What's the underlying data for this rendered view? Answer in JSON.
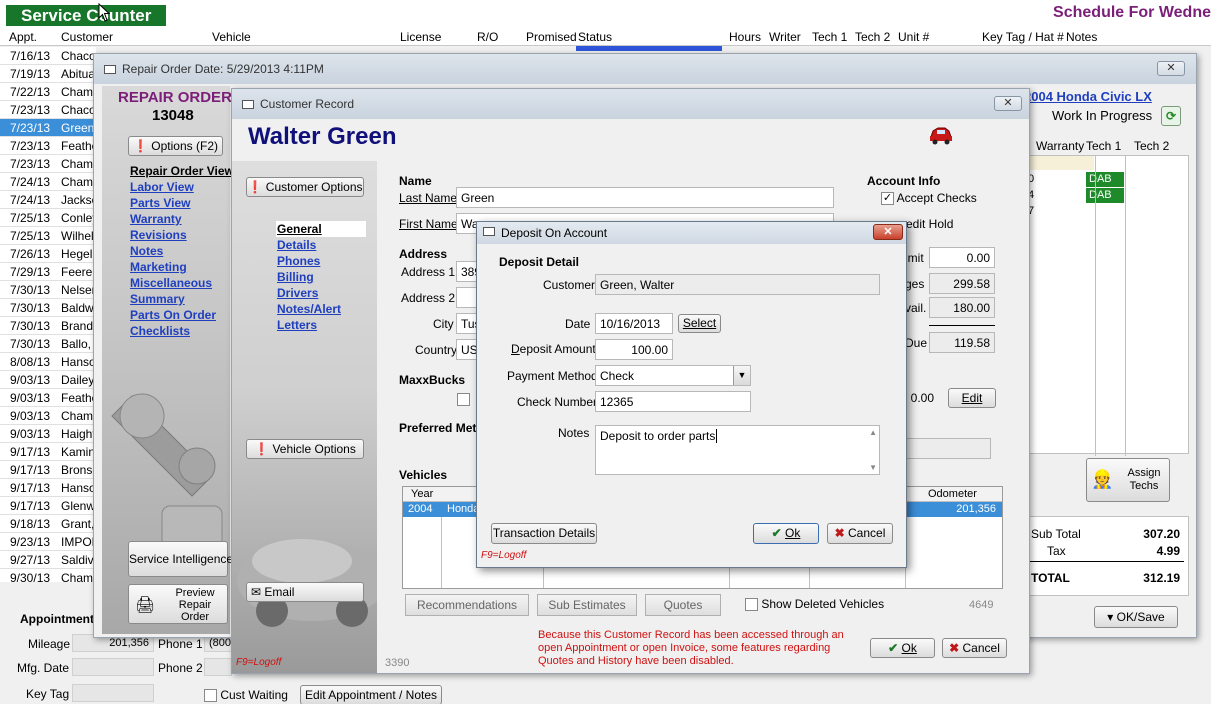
{
  "top": {
    "app_title": "Service Counter",
    "schedule_title": "Schedule For Wedne"
  },
  "grid": {
    "headers": [
      "Appt.",
      "Customer",
      "Vehicle",
      "License",
      "R/O",
      "Promised",
      "Status",
      "Hours",
      "Writer",
      "Tech 1",
      "Tech 2",
      "Unit #",
      "Key Tag / Hat #",
      "Notes"
    ],
    "rows": [
      {
        "date": "7/16/13",
        "cust": "Chaco"
      },
      {
        "date": "7/19/13",
        "cust": "Abitua"
      },
      {
        "date": "7/22/13",
        "cust": "Chamb"
      },
      {
        "date": "7/23/13",
        "cust": "Chaco"
      },
      {
        "date": "7/23/13",
        "cust": "Green"
      },
      {
        "date": "7/23/13",
        "cust": "Feathe"
      },
      {
        "date": "7/23/13",
        "cust": "Chamb"
      },
      {
        "date": "7/24/13",
        "cust": "Chamb"
      },
      {
        "date": "7/24/13",
        "cust": "Jackso"
      },
      {
        "date": "7/25/13",
        "cust": "Conley"
      },
      {
        "date": "7/25/13",
        "cust": "Wilhelr"
      },
      {
        "date": "7/26/13",
        "cust": "Hegel,"
      },
      {
        "date": "7/29/13",
        "cust": "Feerer"
      },
      {
        "date": "7/30/13",
        "cust": "Nelser"
      },
      {
        "date": "7/30/13",
        "cust": "Baldwi"
      },
      {
        "date": "7/30/13",
        "cust": "Brande"
      },
      {
        "date": "7/30/13",
        "cust": "Ballo,"
      },
      {
        "date": "8/08/13",
        "cust": "Hanso"
      },
      {
        "date": "9/03/13",
        "cust": "Dailey"
      },
      {
        "date": "9/03/13",
        "cust": "Feathe"
      },
      {
        "date": "9/03/13",
        "cust": "Chamb"
      },
      {
        "date": "9/03/13",
        "cust": "Haight"
      },
      {
        "date": "9/17/13",
        "cust": "Kamins"
      },
      {
        "date": "9/17/13",
        "cust": "Bronsc"
      },
      {
        "date": "9/17/13",
        "cust": "Hanso"
      },
      {
        "date": "9/17/13",
        "cust": "Glenw"
      },
      {
        "date": "9/18/13",
        "cust": "Grant,"
      },
      {
        "date": "9/23/13",
        "cust": "IMPOR"
      },
      {
        "date": "9/27/13",
        "cust": "Saldiva"
      },
      {
        "date": "9/30/13",
        "cust": "Chamb"
      }
    ]
  },
  "bottom": {
    "appointment_label": "Appointment",
    "mileage_label": "Mileage",
    "mileage_value": "201,356",
    "mfg_date_label": "Mfg. Date",
    "key_tag_label": "Key Tag",
    "phone1_label": "Phone 1",
    "phone1_value": "(800",
    "phone2_label": "Phone 2",
    "cust_waiting_label": "Cust Waiting",
    "edit_appt_label": "Edit Appointment / Notes"
  },
  "ro": {
    "title": "Repair Order Date:  5/29/2013   4:11PM",
    "close": "✕",
    "heading": "REPAIR ORDER",
    "number": "13048",
    "options_label": "Options (F2)",
    "links": [
      "Repair Order View",
      "Labor View",
      "Parts View",
      "Warranty",
      "Revisions",
      "Notes",
      "Marketing",
      "Miscellaneous",
      "Summary",
      "Parts On Order",
      "Checklists"
    ],
    "service_intelligence": "Service Intelligence",
    "preview_label": "Preview Repair Order",
    "vehicle_link": "2004 Honda  Civic LX",
    "status": "Work In Progress",
    "line_headers": [
      "Warranty",
      "Tech 1",
      "Tech 2"
    ],
    "line_frag": [
      "0",
      "4",
      "7"
    ],
    "tech1_values": [
      "DAB",
      "DAB"
    ],
    "assign_techs": "Assign Techs",
    "totals": {
      "sub_total_label": "Sub Total",
      "sub_total_value": "307.20",
      "tax_label": "Tax",
      "tax_value": "4.99",
      "total_label": "TOTAL",
      "total_value": "312.19"
    },
    "ok_save": "OK/Save"
  },
  "cr": {
    "title": "Customer Record",
    "close": "✕",
    "customer_name": "Walter Green",
    "customer_options": "Customer Options",
    "tabs": [
      "General",
      "Details",
      "Phones",
      "Billing",
      "Drivers",
      "Notes/Alert",
      "Letters"
    ],
    "vehicle_options": "Vehicle Options",
    "email": "Email",
    "f9": "F9=Logoff",
    "name_group": "Name",
    "last_name_label": "Last Name",
    "last_name_value": "Green",
    "first_name_label": "First Name",
    "first_name_value": "Wa",
    "address_group": "Address",
    "address1_label": "Address 1",
    "address1_value": "389",
    "address2_label": "Address 2",
    "city_label": "City",
    "city_value": "Tus",
    "country_label": "Country",
    "country_value": "US",
    "maxxbucks_label": "MaxxBucks",
    "preferred_label": "Preferred Met",
    "vehicles_group": "Vehicles",
    "veh_headers": [
      "Year",
      "Odometer"
    ],
    "veh_row": {
      "year": "2004",
      "make": "Honda",
      "odometer": "201,356"
    },
    "account_info": "Account Info",
    "accept_checks": "Accept Checks",
    "credit_hold": "edit Hold",
    "account_values": [
      {
        "label": "imit",
        "value": "0.00"
      },
      {
        "label": "ges",
        "value": "299.58"
      },
      {
        "label": "vail.",
        "value": "180.00"
      },
      {
        "label": "Due",
        "value": "119.58"
      }
    ],
    "maxx_value": "0.00",
    "edit_btn": "Edit",
    "recommendations": "Recommendations",
    "sub_estimates": "Sub Estimates",
    "quotes": "Quotes",
    "show_deleted": "Show Deleted Vehicles",
    "count_right": "4649",
    "count_left": "3390",
    "note": "Because this Customer Record has been accessed through an open Appointment or open Invoice, some features regarding Quotes and History have been disabled.",
    "ok": "Ok",
    "cancel": "Cancel"
  },
  "dep": {
    "title": "Deposit On Account",
    "close": "✕",
    "group": "Deposit Detail",
    "customer_label": "Customer",
    "customer_value": "Green, Walter",
    "date_label": "Date",
    "date_value": "10/16/2013",
    "select": "Select",
    "amount_label": "Deposit Amount",
    "amount_value": "100.00",
    "method_label": "Payment Method",
    "method_value": "Check",
    "check_label": "Check Number",
    "check_value": "12365",
    "notes_label": "Notes",
    "notes_value": "Deposit to order parts",
    "transaction_details": "Transaction Details",
    "ok": "Ok",
    "cancel": "Cancel",
    "f9": "F9=Logoff"
  }
}
